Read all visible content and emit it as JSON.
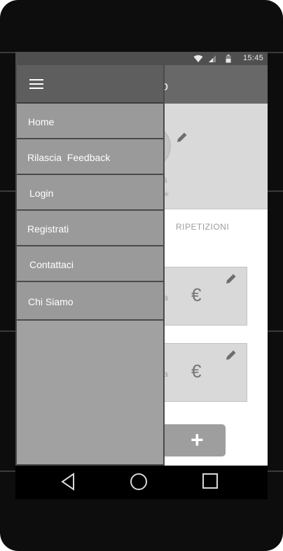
{
  "status_bar": {
    "time": "15:45",
    "icons": [
      "wifi-icon",
      "signal-icon",
      "battery-icon"
    ]
  },
  "app_bar": {
    "title": "lo"
  },
  "profile": {
    "subtitle_fragment": "à",
    "rating_fragment": "★"
  },
  "tabs": {
    "repetitions_label": "RIPETIZIONI"
  },
  "cards": [
    {
      "fragment": "a",
      "currency": "€"
    },
    {
      "fragment": "a",
      "currency": "€"
    }
  ],
  "add_button": {
    "label": "+"
  },
  "drawer": {
    "menu_icon": "menu-icon",
    "items": [
      {
        "label": "Home"
      },
      {
        "label": "Rilascia  Feedback"
      },
      {
        "label": "Login"
      },
      {
        "label": "Registrati"
      },
      {
        "label": "Contattaci"
      },
      {
        "label": "Chi Siamo"
      }
    ]
  },
  "system_nav": [
    "back-icon",
    "home-icon",
    "recents-icon"
  ],
  "colors": {
    "drawer": "#9a9a9a",
    "drawer_header": "#5e5e5e",
    "app_bar": "#686868",
    "status_bar": "#4f4f4f"
  }
}
